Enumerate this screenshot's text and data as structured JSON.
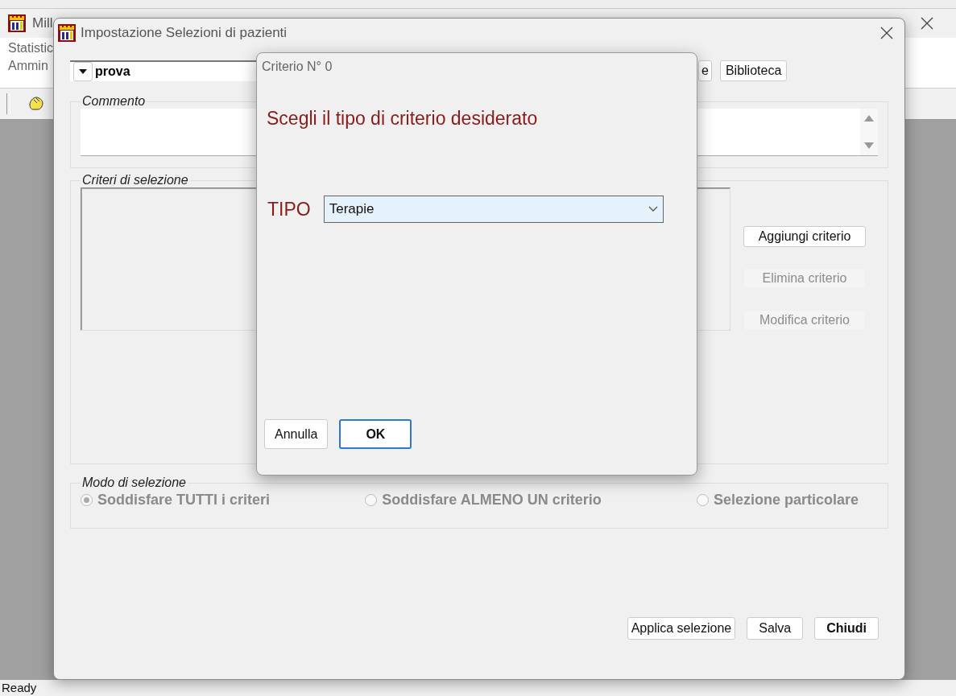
{
  "main_window": {
    "title": "Mill",
    "menu": [
      "Statistic",
      "Ammin"
    ],
    "status_bar": "Ready"
  },
  "selection_dialog": {
    "title": "Impostazione Selezioni di pazienti",
    "selection_name": "prova",
    "top_buttons": [
      {
        "label": "e",
        "disabled": false
      },
      {
        "label": "Biblioteca",
        "disabled": false
      }
    ],
    "comment_label": "Commento",
    "criteria": {
      "label": "Criteri di selezione",
      "buttons": [
        {
          "label": "Aggiungi criterio",
          "disabled": false
        },
        {
          "label": "Elimina criterio",
          "disabled": true
        },
        {
          "label": "Modifica criterio",
          "disabled": true
        }
      ]
    },
    "mode": {
      "label": "Modo di selezione",
      "options": [
        {
          "label": "Soddisfare TUTTI i criteri",
          "selected": true,
          "disabled": true
        },
        {
          "label": "Soddisfare ALMENO UN criterio",
          "selected": false,
          "disabled": true
        },
        {
          "label": "Selezione particolare",
          "selected": false,
          "disabled": true
        }
      ]
    },
    "buttons": [
      {
        "label": "Applica selezione",
        "default": false
      },
      {
        "label": "Salva",
        "default": false
      },
      {
        "label": "Chiudi",
        "default": true
      }
    ]
  },
  "criterion_dialog": {
    "title": "Criterio N° 0",
    "heading": "Scegli il tipo di criterio desiderato",
    "type_label": "TIPO",
    "type_value": "Terapie",
    "buttons": [
      {
        "label": "Annulla",
        "default": false
      },
      {
        "label": "OK",
        "default": true
      }
    ]
  }
}
